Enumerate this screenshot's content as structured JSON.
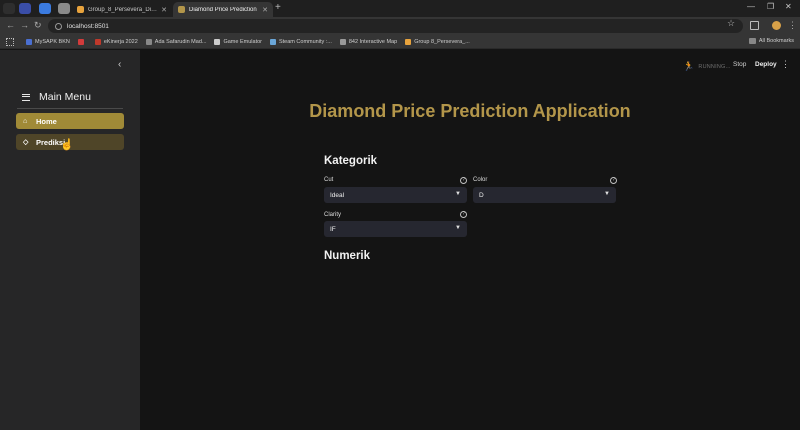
{
  "browser": {
    "tabs": [
      {
        "title": "Group_8_Persevera_Diamond_Pr",
        "favicon_color": "#e8a33d"
      },
      {
        "title": "Diamond Price Prediction",
        "favicon_color": "#b3964a"
      }
    ],
    "url": "localhost:8501",
    "bookmarks": [
      {
        "label": "MySAPK BKN",
        "color": "#4a6fd1"
      },
      {
        "label": "",
        "color": "#d33b3b"
      },
      {
        "label": "eKinerja 2022",
        "color": "#c0392b"
      },
      {
        "label": "Ada Safarudin Mad...",
        "color": "#888888"
      },
      {
        "label": "Game Emulator",
        "color": "#cccccc"
      },
      {
        "label": "Steam Community :...",
        "color": "#6aa6d8"
      },
      {
        "label": "842 Interactive Map",
        "color": "#999999"
      },
      {
        "label": "Group 8_Persevera_...",
        "color": "#e8a33d"
      }
    ],
    "all_bookmarks": "All Bookmarks"
  },
  "sidebar": {
    "title": "Main Menu",
    "items": [
      {
        "label": "Home",
        "icon": "home-icon",
        "glyph": "⌂"
      },
      {
        "label": "Prediksi",
        "icon": "diamond-icon",
        "glyph": "◇"
      }
    ]
  },
  "header": {
    "status": "RUNNING...",
    "stop": "Stop",
    "deploy": "Deploy"
  },
  "main": {
    "title": "Diamond Price Prediction Application",
    "kategorik": "Kategorik",
    "numerik": "Numerik",
    "fields": {
      "cut": {
        "label": "Cut",
        "value": "Ideal"
      },
      "color": {
        "label": "Color",
        "value": "D"
      },
      "clarity": {
        "label": "Clarity",
        "value": "IF"
      }
    }
  },
  "colors": {
    "accent": "#b3964a",
    "nav_active": "#a08a37",
    "nav_inactive": "#4f4528",
    "select_bg": "#262730"
  }
}
